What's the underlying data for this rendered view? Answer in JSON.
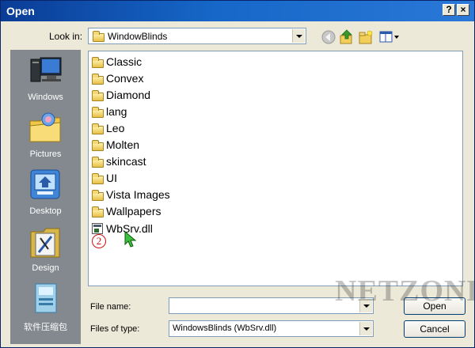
{
  "window": {
    "title": "Open",
    "help_button": "?",
    "close_button": "×"
  },
  "toolbar": {
    "lookin_label": "Look in:",
    "lookin_value": "WindowBlinds",
    "icons": [
      "back-icon",
      "up-folder-icon",
      "new-folder-icon",
      "view-menu-icon"
    ]
  },
  "places": [
    {
      "label": "Windows",
      "icon": "computer-icon"
    },
    {
      "label": "Pictures",
      "icon": "pictures-folder-icon"
    },
    {
      "label": "Desktop",
      "icon": "desktop-icon"
    },
    {
      "label": "Design",
      "icon": "design-icon"
    },
    {
      "label": "软件压缩包",
      "icon": "archive-icon"
    }
  ],
  "files": [
    {
      "name": "Classic",
      "type": "folder"
    },
    {
      "name": "Convex",
      "type": "folder"
    },
    {
      "name": "Diamond",
      "type": "folder"
    },
    {
      "name": "lang",
      "type": "folder"
    },
    {
      "name": "Leo",
      "type": "folder"
    },
    {
      "name": "Molten",
      "type": "folder"
    },
    {
      "name": "skincast",
      "type": "folder"
    },
    {
      "name": "UI",
      "type": "folder"
    },
    {
      "name": "Vista Images",
      "type": "folder"
    },
    {
      "name": "Wallpapers",
      "type": "folder"
    },
    {
      "name": "WbSrv.dll",
      "type": "file"
    }
  ],
  "annotation": {
    "step_number": "2",
    "color": "#d01010"
  },
  "form": {
    "filename_label": "File name:",
    "filename_value": "",
    "filetype_label": "Files of type:",
    "filetype_value": "WindowsBlinds (WbSrv.dll)"
  },
  "buttons": {
    "open": "Open",
    "cancel": "Cancel"
  },
  "watermark": "NETZONE",
  "colors": {
    "titlebar": "#0a3c96",
    "places_bar": "#84898f",
    "dialog_bg": "#ece9d8"
  }
}
